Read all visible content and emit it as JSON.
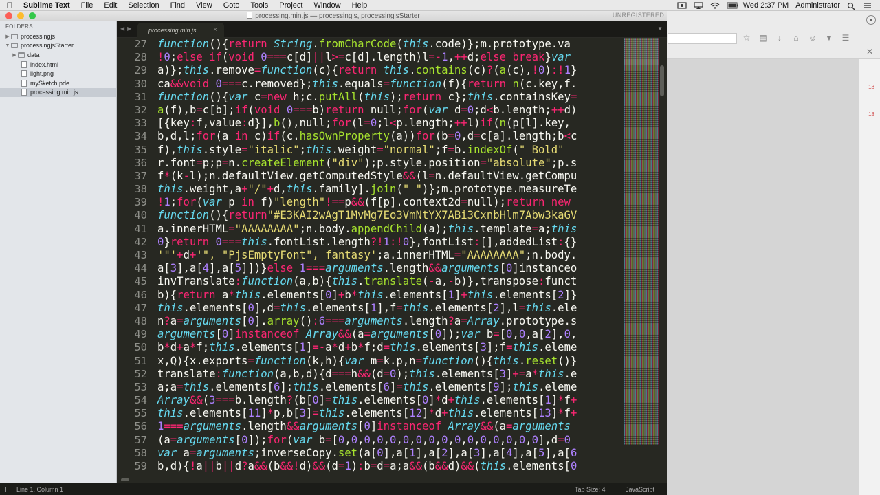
{
  "menubar": {
    "app_name": "Sublime Text",
    "items": [
      "File",
      "Edit",
      "Selection",
      "Find",
      "View",
      "Goto",
      "Tools",
      "Project",
      "Window",
      "Help"
    ],
    "clock": "Wed 2:37 PM",
    "user": "Administrator"
  },
  "window": {
    "title": "processing.min.js — processingjs, processingjsStarter",
    "unregistered": "UNREGISTERED",
    "traffic_lights": [
      "#fc5f57",
      "#fdbc2e",
      "#34c84a"
    ]
  },
  "sidebar": {
    "title": "FOLDERS",
    "items": [
      {
        "label": "processingjs",
        "type": "folder",
        "expanded": false
      },
      {
        "label": "processingjsStarter",
        "type": "folder",
        "expanded": true
      },
      {
        "label": "data",
        "type": "folder",
        "expanded": false
      },
      {
        "label": "index.html",
        "type": "file"
      },
      {
        "label": "light.png",
        "type": "file"
      },
      {
        "label": "mySketch.pde",
        "type": "file"
      },
      {
        "label": "processing.min.js",
        "type": "file",
        "selected": true
      }
    ]
  },
  "editor": {
    "tab_label": "processing.min.js",
    "tab_close": "×",
    "line_numbers": [
      "27",
      "28",
      "29",
      "30",
      "31",
      "32",
      "33",
      "34",
      "35",
      "36",
      "37",
      "38",
      "39",
      "40",
      "41",
      "42",
      "43",
      "44",
      "45",
      "46",
      "47",
      "48",
      "49",
      "50",
      "51",
      "52",
      "53",
      "54",
      "55",
      "56",
      "57",
      "58",
      "59"
    ],
    "code_lines": [
      "function(){return String.fromCharCode(this.code)};m.prototype.va",
      "!0;else if(void 0===c[d]||l>=c[d].length)l=-1,++d;else break}var",
      "a)};this.remove=function(c){return this.contains(c)?(a(c),!0):!1}",
      "ca&&void 0===c.removed};this.equals=function(f){return n(c.key,f.",
      "function(){var c=new h;c.putAll(this);return c};this.containsKey=",
      "a(f),b=c[b];if(void 0===b)return null;for(var d=0;d<b.length;++d)",
      "[{key:f,value:d}],b(),null;for(l=0;l<p.length;++l)if(n(p[l].key,",
      "b,d,l;for(a in c)if(c.hasOwnProperty(a))for(b=0,d=c[a].length;b<c",
      "f),this.style=\"italic\";this.weight=\"normal\";f=b.indexOf(\" Bold\"",
      "r.font=p;p=n.createElement(\"div\");p.style.position=\"absolute\";p.s",
      "f*(k-l);n.defaultView.getComputedStyle&&(l=n.defaultView.getCompu",
      "this.weight,a+\"/\"+d,this.family].join(\" \")};m.prototype.measureTe",
      "!1;for(var p in f)\"length\"!==p&&(f[p].context2d=null);return new ",
      "function(){return\"#E3KAI2wAgT1MvMg7Eo3VmNtYX7ABi3CxnbHlm7Abw3kaGV",
      "a.innerHTML=\"AAAAAAAA\";n.body.appendChild(a);this.template=a;this",
      "0}return 0===this.fontList.length?!1:!0},fontList:[],addedList:{}",
      "'\"'+d+'\", \"PjsEmptyFont\", fantasy';a.innerHTML=\"AAAAAAAA\";n.body.",
      "a[3],a[4],a[5]])}else 1===arguments.length&&arguments[0]instanceo",
      "invTranslate:function(a,b){this.translate(-a,-b)},transpose:funct",
      "b){return a*this.elements[0]+b*this.elements[1]+this.elements[2]}",
      "this.elements[0],d=this.elements[1],f=this.elements[2],l=this.ele",
      "n?a=arguments[0].array():6===arguments.length?a=Array.prototype.s",
      "arguments[0]instanceof Array&&(a=arguments[0]);var b=[0,0,a[2],0,",
      "b*d+a*f;this.elements[1]=-a*d+b*f;d=this.elements[3];f=this.eleme",
      "x,Q){x.exports=function(k,h){var m=k.p,n=function(){this.reset()}",
      "translate:function(a,b,d){d===h&&(d=0);this.elements[3]+=a*this.e",
      "a;a=this.elements[6];this.elements[6]=this.elements[9];this.eleme",
      "Array&&(3===b.length?(b[0]=this.elements[0]*d+this.elements[1]*f+",
      "this.elements[11]*p,b[3]=this.elements[12]*d+this.elements[13]*f+",
      "1===arguments.length&&arguments[0]instanceof Array&&(a=arguments",
      "(a=arguments[0]);for(var b=[0,0,0,0,0,0,0,0,0,0,0,0,0,0,0,0],d=0",
      "var a=arguments;inverseCopy.set(a[0],a[1],a[2],a[3],a[4],a[5],a[6",
      "b,d){!a||b||d?a&&(b&&!d)&&(d=1):b=d=a;a&&(b&&d)&&(this.elements[0"
    ]
  },
  "statusbar": {
    "position": "Line 1, Column 1",
    "tab_size": "Tab Size: 4",
    "syntax": "JavaScript"
  },
  "browser": {
    "badges": [
      "18",
      "18"
    ]
  },
  "colors": {
    "editor_bg": "#272822",
    "keyword": "#f92672",
    "string": "#e6db74",
    "number": "#ae81ff",
    "function": "#a6e22e",
    "storage": "#66d9ef",
    "parameter": "#fd971f",
    "text": "#f8f8f2"
  },
  "icons": [
    "apple-icon",
    "folder-icon",
    "file-icon",
    "close-icon",
    "search-icon",
    "wifi-icon",
    "battery-icon",
    "star-icon",
    "download-icon",
    "home-icon",
    "menu-icon"
  ]
}
